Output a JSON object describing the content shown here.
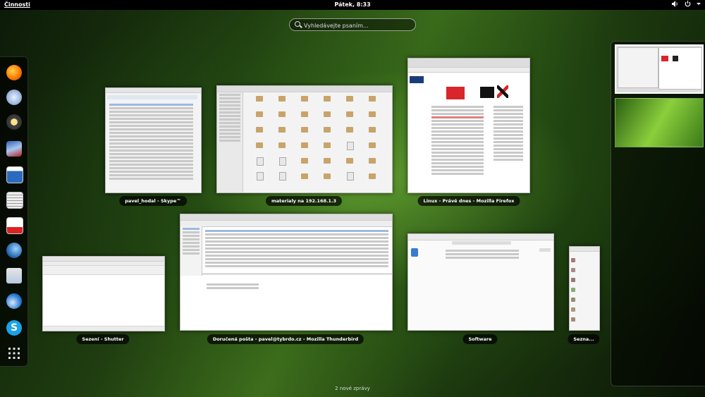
{
  "topbar": {
    "activities": "Činnosti",
    "clock": "Pátek,  8:33",
    "tray_icons": [
      "volume-icon",
      "power-icon"
    ]
  },
  "search": {
    "placeholder": "Vyhledávejte psaním…"
  },
  "dash": {
    "apps": [
      "firefox",
      "empathy",
      "rhythmbox",
      "shotwell",
      "writer",
      "documents",
      "document-viewer",
      "thunderbird-alt",
      "software",
      "thunderbird",
      "skype",
      "show-applications"
    ]
  },
  "windows": [
    {
      "id": "skype",
      "label": "pavel_hodal - Skype™"
    },
    {
      "id": "nautilus",
      "label": "materialy na 192.168.1.3"
    },
    {
      "id": "firefox",
      "label": "Linux - Právě dnes - Mozilla Firefox"
    },
    {
      "id": "shutter",
      "label": "Sezení - Shutter"
    },
    {
      "id": "thunderbird",
      "label": "Doručená pošta - pavel@tybrdo.cz - Mozilla Thunderbird"
    },
    {
      "id": "software",
      "label": "Software"
    },
    {
      "id": "contacts",
      "label": "Sezna..."
    }
  ],
  "notifications": {
    "text": "2 nové zprávy"
  }
}
